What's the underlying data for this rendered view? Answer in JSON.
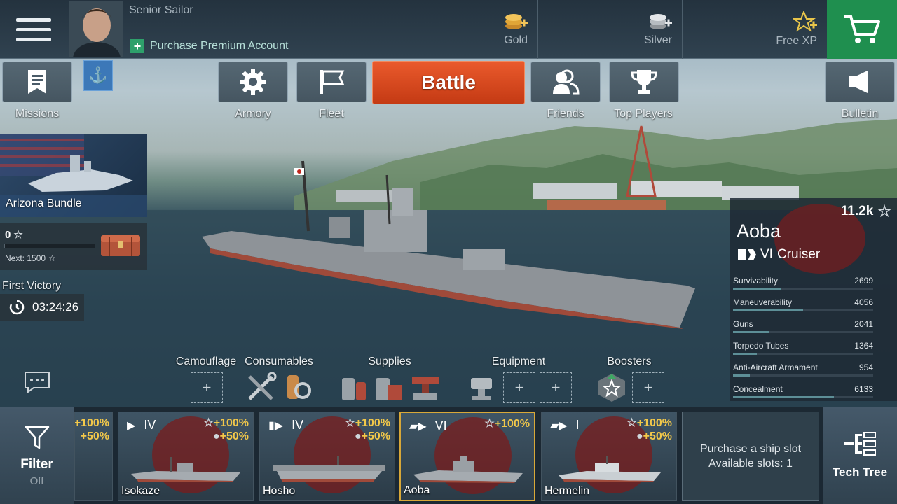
{
  "topbar": {
    "rank": "Senior Sailor",
    "premium_label": "Purchase Premium Account",
    "gold_label": "Gold",
    "silver_label": "Silver",
    "freexp_label": "Free XP"
  },
  "nav": {
    "missions": "Missions",
    "armory": "Armory",
    "fleet": "Fleet",
    "battle": "Battle",
    "friends": "Friends",
    "top_players": "Top Players",
    "bulletin": "Bulletin"
  },
  "bundle": {
    "label": "Arizona Bundle"
  },
  "progress": {
    "stars": "0",
    "next": "Next: 1500"
  },
  "first_victory": {
    "label": "First Victory",
    "timer": "03:24:26"
  },
  "ship": {
    "xp": "11.2k",
    "name": "Aoba",
    "tier": "VI",
    "class": "Cruiser",
    "stats": [
      {
        "label": "Survivability",
        "value": "2699",
        "fill": 0.34
      },
      {
        "label": "Maneuverability",
        "value": "4056",
        "fill": 0.5
      },
      {
        "label": "Guns",
        "value": "2041",
        "fill": 0.26
      },
      {
        "label": "Torpedo Tubes",
        "value": "1364",
        "fill": 0.17
      },
      {
        "label": "Anti-Aircraft Armament",
        "value": "954",
        "fill": 0.12
      },
      {
        "label": "Concealment",
        "value": "6133",
        "fill": 0.72
      }
    ]
  },
  "slots": {
    "camouflage": "Camouflage",
    "consumables": "Consumables",
    "supplies": "Supplies",
    "equipment": "Equipment",
    "boosters": "Boosters"
  },
  "carousel": {
    "filter_label": "Filter",
    "filter_state": "Off",
    "partial_bonus_a": "+100%",
    "partial_bonus_b": "+50%",
    "cards": [
      {
        "name": "Isokaze",
        "tier": "IV",
        "bonus_a": "+100%",
        "bonus_b": "+50%"
      },
      {
        "name": "Hosho",
        "tier": "IV",
        "bonus_a": "+100%",
        "bonus_b": "+50%"
      },
      {
        "name": "Aoba",
        "tier": "VI",
        "bonus_a": "+100%"
      },
      {
        "name": "Hermelin",
        "tier": "I",
        "bonus_a": "+100%",
        "bonus_b": "+50%"
      }
    ],
    "purchase_line1": "Purchase a ship slot",
    "purchase_line2": "Available slots: 1",
    "techtree_label": "Tech Tree"
  }
}
